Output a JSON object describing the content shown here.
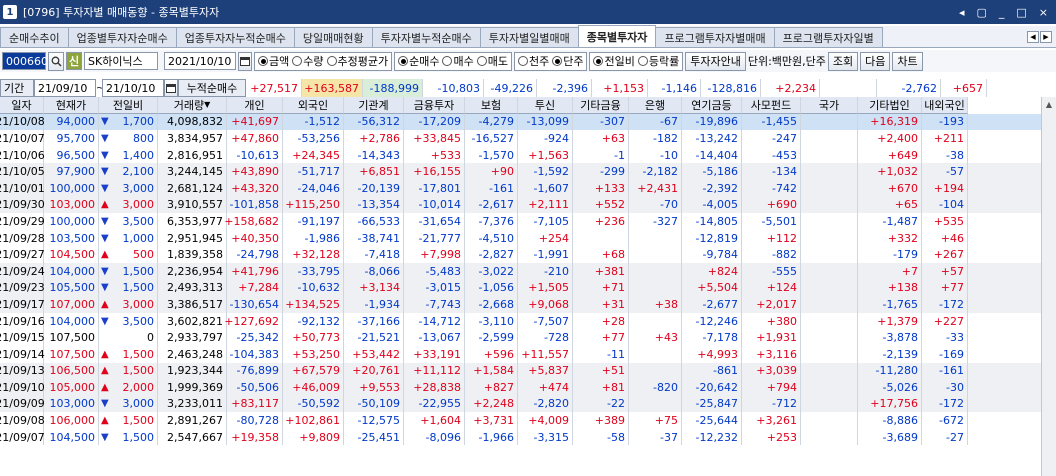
{
  "window": {
    "title": "[0796] 투자자별 매매동향 - 종목별투자자",
    "num": "1",
    "ctrl_prev": "◂",
    "ctrl_restore": "▢",
    "ctrl_min": "_",
    "ctrl_max": "□",
    "ctrl_close": "×"
  },
  "tabs": [
    "순매수추이",
    "업종별투자자순매수",
    "업종투자자누적순매수",
    "당일매매현황",
    "투자자별누적순매수",
    "투자자별일별매매",
    "종목별투자자",
    "프로그램투자자별매매",
    "프로그램투자자일별"
  ],
  "active_tab": 6,
  "toolbar": {
    "code": "000660",
    "search_icon": "search-icon",
    "credit": "신",
    "name": "SK하이닉스",
    "date": "2021/10/10",
    "calendar_icon": "calendar-icon",
    "opt1": [
      "금액",
      "수량",
      "추정평균가"
    ],
    "opt1_sel": 0,
    "opt2": [
      "순매수",
      "매수",
      "매도"
    ],
    "opt2_sel": 0,
    "opt3": [
      "천주",
      "단주"
    ],
    "opt3_sel": 1,
    "opt4": [
      "전일비",
      "등락률"
    ],
    "opt4_sel": 0,
    "guide_btn": "투자자안내",
    "unit": "단위:백만원,단주",
    "query_btn": "조회",
    "next_btn": "다음",
    "chart_btn": "차트"
  },
  "datebar": {
    "label": "기간",
    "from": "21/09/10",
    "to": "21/10/10",
    "cum_label": "누적순매수"
  },
  "sums": [
    "+27,517",
    "+163,587",
    "-188,999",
    "-10,803",
    "-49,226",
    "-2,396",
    "+1,153",
    "-1,146",
    "-128,816",
    "+2,234",
    "",
    "-2,762",
    "+657"
  ],
  "headers": [
    "일자",
    "현재가",
    "전일비",
    "거래량",
    "개인",
    "외국인",
    "기관계",
    "금융투자",
    "보험",
    "투신",
    "기타금융",
    "은행",
    "연기금등",
    "사모펀드",
    "국가",
    "기타법인",
    "내외국인"
  ],
  "rows": [
    [
      "21/10/08",
      "94,000",
      "dn",
      "1,700",
      "4,098,832",
      "+41,697",
      "-1,512",
      "-56,312",
      "-17,209",
      "-4,279",
      "-13,099",
      "-307",
      "-67",
      "-19,896",
      "-1,455",
      "",
      "+16,319",
      "-193"
    ],
    [
      "21/10/07",
      "95,700",
      "dn",
      "800",
      "3,834,957",
      "+47,860",
      "-53,256",
      "+2,786",
      "+33,845",
      "-16,527",
      "-924",
      "+63",
      "-182",
      "-13,242",
      "-247",
      "",
      "+2,400",
      "+211"
    ],
    [
      "21/10/06",
      "96,500",
      "dn",
      "1,400",
      "2,816,951",
      "-10,613",
      "+24,345",
      "-14,343",
      "+533",
      "-1,570",
      "+1,563",
      "-1",
      "-10",
      "-14,404",
      "-453",
      "",
      "+649",
      "-38"
    ],
    [
      "21/10/05",
      "97,900",
      "dn",
      "2,100",
      "3,244,145",
      "+43,890",
      "-51,717",
      "+6,851",
      "+16,155",
      "+90",
      "-1,592",
      "-299",
      "-2,182",
      "-5,186",
      "-134",
      "",
      "+1,032",
      "-57"
    ],
    [
      "21/10/01",
      "100,000",
      "dn",
      "3,000",
      "2,681,124",
      "+43,320",
      "-24,046",
      "-20,139",
      "-17,801",
      "-161",
      "-1,607",
      "+133",
      "+2,431",
      "-2,392",
      "-742",
      "",
      "+670",
      "+194"
    ],
    [
      "21/09/30",
      "103,000",
      "up",
      "3,000",
      "3,910,557",
      "-101,858",
      "+115,250",
      "-13,354",
      "-10,014",
      "-2,617",
      "+2,111",
      "+552",
      "-70",
      "-4,005",
      "+690",
      "",
      "+65",
      "-104"
    ],
    [
      "21/09/29",
      "100,000",
      "dn",
      "3,500",
      "6,353,977",
      "+158,682",
      "-91,197",
      "-66,533",
      "-31,654",
      "-7,376",
      "-7,105",
      "+236",
      "-327",
      "-14,805",
      "-5,501",
      "",
      "-1,487",
      "+535"
    ],
    [
      "21/09/28",
      "103,500",
      "dn",
      "1,000",
      "2,951,945",
      "+40,350",
      "-1,986",
      "-38,741",
      "-21,777",
      "-4,510",
      "+254",
      "",
      "",
      "-12,819",
      "+112",
      "",
      "+332",
      "+46"
    ],
    [
      "21/09/27",
      "104,500",
      "up",
      "500",
      "1,839,358",
      "-24,798",
      "+32,128",
      "-7,418",
      "+7,998",
      "-2,827",
      "-1,991",
      "+68",
      "",
      "-9,784",
      "-882",
      "",
      "-179",
      "+267"
    ],
    [
      "21/09/24",
      "104,000",
      "dn",
      "1,500",
      "2,236,954",
      "+41,796",
      "-33,795",
      "-8,066",
      "-5,483",
      "-3,022",
      "-210",
      "+381",
      "",
      "+824",
      "-555",
      "",
      "+7",
      "+57"
    ],
    [
      "21/09/23",
      "105,500",
      "dn",
      "1,500",
      "2,493,313",
      "+7,284",
      "-10,632",
      "+3,134",
      "-3,015",
      "-1,056",
      "+1,505",
      "+71",
      "",
      "+5,504",
      "+124",
      "",
      "+138",
      "+77"
    ],
    [
      "21/09/17",
      "107,000",
      "up",
      "3,000",
      "3,386,517",
      "-130,654",
      "+134,525",
      "-1,934",
      "-7,743",
      "-2,668",
      "+9,068",
      "+31",
      "+38",
      "-2,677",
      "+2,017",
      "",
      "-1,765",
      "-172"
    ],
    [
      "21/09/16",
      "104,000",
      "dn",
      "3,500",
      "3,602,821",
      "+127,692",
      "-92,132",
      "-37,166",
      "-14,712",
      "-3,110",
      "-7,507",
      "+28",
      "",
      "-12,246",
      "+380",
      "",
      "+1,379",
      "+227"
    ],
    [
      "21/09/15",
      "107,500",
      "",
      "0",
      "2,933,797",
      "-25,342",
      "+50,773",
      "-21,521",
      "-13,067",
      "-2,599",
      "-728",
      "+77",
      "+43",
      "-7,178",
      "+1,931",
      "",
      "-3,878",
      "-33"
    ],
    [
      "21/09/14",
      "107,500",
      "up",
      "1,500",
      "2,463,248",
      "-104,383",
      "+53,250",
      "+53,442",
      "+33,191",
      "+596",
      "+11,557",
      "-11",
      "",
      "+4,993",
      "+3,116",
      "",
      "-2,139",
      "-169"
    ],
    [
      "21/09/13",
      "106,500",
      "up",
      "1,500",
      "1,923,344",
      "-76,899",
      "+67,579",
      "+20,761",
      "+11,112",
      "+1,584",
      "+5,837",
      "+51",
      "",
      "-861",
      "+3,039",
      "",
      "-11,280",
      "-161"
    ],
    [
      "21/09/10",
      "105,000",
      "up",
      "2,000",
      "1,999,369",
      "-50,506",
      "+46,009",
      "+9,553",
      "+28,838",
      "+827",
      "+474",
      "+81",
      "-820",
      "-20,642",
      "+794",
      "",
      "-5,026",
      "-30"
    ],
    [
      "21/09/09",
      "103,000",
      "dn",
      "3,000",
      "3,233,011",
      "+83,117",
      "-50,592",
      "-50,109",
      "-22,955",
      "+2,248",
      "-2,820",
      "-22",
      "",
      "-25,847",
      "-712",
      "",
      "+17,756",
      "-172"
    ],
    [
      "21/09/08",
      "106,000",
      "up",
      "1,500",
      "2,891,267",
      "-80,728",
      "+102,861",
      "-12,575",
      "+1,604",
      "+3,731",
      "+4,009",
      "+389",
      "+75",
      "-25,644",
      "+3,261",
      "",
      "-8,886",
      "-672"
    ],
    [
      "21/09/07",
      "104,500",
      "dn",
      "1,500",
      "2,547,667",
      "+19,358",
      "+9,809",
      "-25,451",
      "-8,096",
      "-1,966",
      "-3,315",
      "-58",
      "-37",
      "-12,232",
      "+253",
      "",
      "-3,689",
      "-27"
    ]
  ]
}
